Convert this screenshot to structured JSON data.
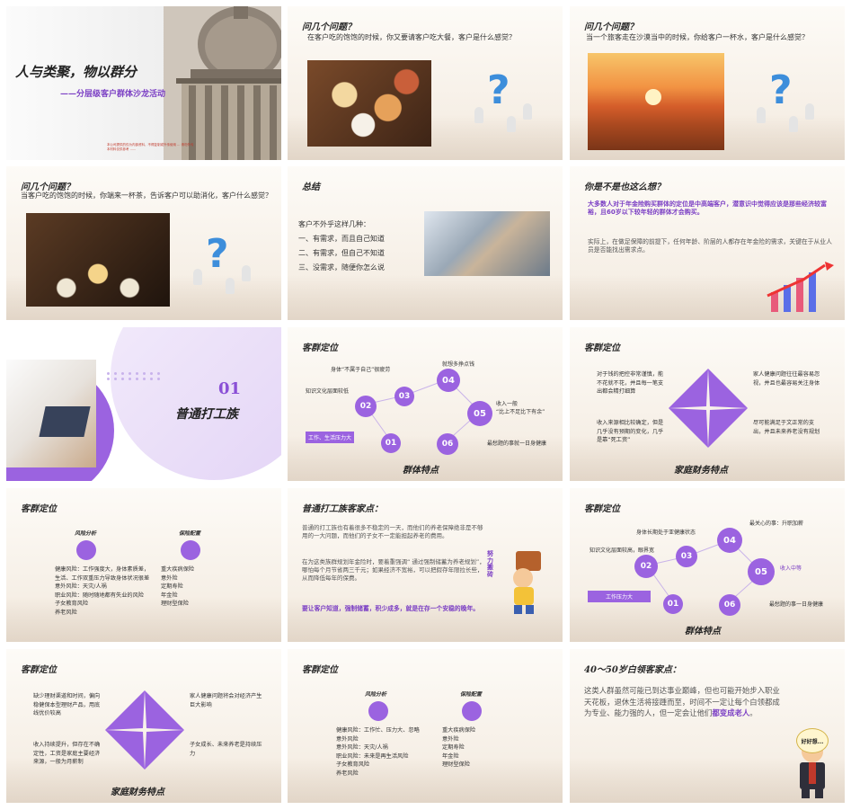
{
  "slide1": {
    "title": "人与类聚，物以群分",
    "subtitle": "——分层级客户群体沙龙活动",
    "fine_print": [
      "本公司提供的仅为内部资料，不得复制或外传使用 ... 请勿外传",
      "本材料仅供参考 ......"
    ]
  },
  "slide2": {
    "heading": "问几个问题？",
    "text": "在客户吃的饱饱的时候，你又要请客户吃大餐，客户是什么感觉？",
    "icon": "question-mark-icon"
  },
  "slide3": {
    "heading": "问几个问题？",
    "text": "当一个旅客走在沙漠当中的时候，你给客户一杯水，客户是什么感觉？",
    "icon": "question-mark-icon"
  },
  "slide4": {
    "heading": "问几个问题？",
    "text": "当客户吃的饱饱的时候，你端来一杯茶，告诉客户可以助消化，客户什么感觉？",
    "icon": "question-mark-icon"
  },
  "slide5": {
    "heading": "总结",
    "intro": "客户不外乎这样几种：",
    "items": [
      "一、有需求，而且自己知道",
      "二、有需求，但自己不知道",
      "三、没需求，随便你怎么说"
    ]
  },
  "slide6": {
    "heading": "你是不是也这么想？",
    "p1": "大多数人对于年金险购买群体的定位是中高端客户，潜意识中觉得应该是那些经济较富裕，且60岁以下较年轻的群体才会购买。",
    "p2": "实际上，在做足保障的前提下，任何年龄、阶层的人都存在年金险的需求，关键在于从业人员是否能找出需求点。"
  },
  "slide7": {
    "number": "01",
    "title": "普通打工族"
  },
  "slide8": {
    "heading": "客群定位",
    "circles": [
      "01",
      "02",
      "03",
      "04",
      "05",
      "06"
    ],
    "labels": [
      "工作、生活压力大",
      "知识文化层面较低",
      "身体“不属于自己”很疲劳",
      "就想多挣点钱",
      "收入一般\n“比上不足比下有余”",
      "最愁题的事就一日身健康"
    ],
    "caption": "群体特点"
  },
  "slide9": {
    "heading": "客群定位",
    "left_top": "对于钱的把控非常谨慎，能不花就不花，并且每一笔支出都会精打细算",
    "right_top": "家人健康问题往往最容易忽视，并且也最容易关注身体",
    "left_bottom": "收入来源相比较确定，但是几乎没有预期的变化，几乎是靠“死工资”",
    "right_bottom": "尽可能满足于文正常的支出，并且未来养老没有规划",
    "caption": "家庭财务特点"
  },
  "slide10": {
    "heading": "客群定位",
    "col1_title": "风险分析",
    "col2_title": "保险配置",
    "col1": [
      "健康风险：工作强度大，身体素质差，",
      "生活、工作双重压力导致身体状况很差",
      "意外风险：天灾/人祸",
      "职业风险：随时随地都有失业的风险",
      "子女教育风险",
      "养老风险"
    ],
    "col2": [
      "重大疾病保险",
      "意外险",
      "定期寿险",
      "年金险",
      "理财型保险"
    ]
  },
  "slide11": {
    "heading": "普通打工族客家点：",
    "p1": "普通的打工族也有着很多不稳定的一天，而他们的养老保障绝非是不够用的一大问题，而他们的子女不一定能担起养老的费用。",
    "p2": "在为这类族群规划年金险时，要着重强调“ 通过强制储蓄为养老规划”，哪怕每个月节省两三千元；如果经济不宽裕，可以把假存年限拉长些，从而降低每年的保费。",
    "p3": "要让客户知道，强制储蓄，积少成多，就是在存一个安稳的晚年。",
    "side_text": "努力搬砖"
  },
  "slide12": {
    "heading": "客群定位",
    "circles": [
      "01",
      "02",
      "03",
      "04",
      "05",
      "06"
    ],
    "labels": [
      "工作压力大",
      "知识文化层面较高，眼界宽",
      "身体长期处于亚健康状态",
      "最关心的事：升职加薪",
      "收入中等",
      "最愁题的事一日身健康"
    ],
    "caption": "群体特点"
  },
  "slide13": {
    "heading": "客群定位",
    "left_top": "缺少理财渠道和时间，偏向稳健保本型理财产品，用底线优价较高",
    "right_top": "家人健康问题将会对经济产生巨大影响",
    "left_bottom": "收入持续提升，但存在不确定性，工资是家庭主要经济来源，一般为月薪制",
    "right_bottom": "子女成长、未来养老是持续压力",
    "caption": "家庭财务特点"
  },
  "slide14": {
    "heading": "客群定位",
    "col1_title": "风险分析",
    "col2_title": "保险配置",
    "col1": [
      "健康风险：工作忙、压力大、忽略",
      "意外风险",
      "意外风险：天灾/人祸",
      "职业风险：未来是再生活风险",
      "子女教育风险",
      "养老风险"
    ],
    "col2": [
      "重大疾病保险",
      "意外险",
      "定期寿险",
      "年金险",
      "理财型保险"
    ]
  },
  "slide15": {
    "heading": "40～50岁白领客家点：",
    "text_a": "这类人群虽然可能已到达事业巅峰，但也可能开始步入职业天花板，退休生活将接踵而至，时间不一定让每个白领都成为专业、能力强的人，但一定会让他们",
    "text_b": "都变成老人",
    "text_c": "。",
    "bubble": "好好想..."
  }
}
